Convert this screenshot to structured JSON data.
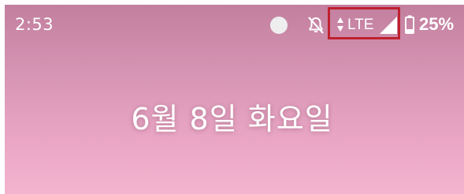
{
  "status_bar": {
    "time": "2:53",
    "network_type": "LTE",
    "battery_percent": "25%",
    "icons": [
      "dot-icon",
      "notifications-off-icon",
      "data-arrows-icon",
      "cell-signal-icon",
      "battery-icon"
    ]
  },
  "lockscreen": {
    "date": "6월 8일 화요일"
  },
  "colors": {
    "highlight_border": "#c0202e",
    "wallpaper_top": "#c27f9e",
    "wallpaper_bottom": "#f3b4cf"
  }
}
